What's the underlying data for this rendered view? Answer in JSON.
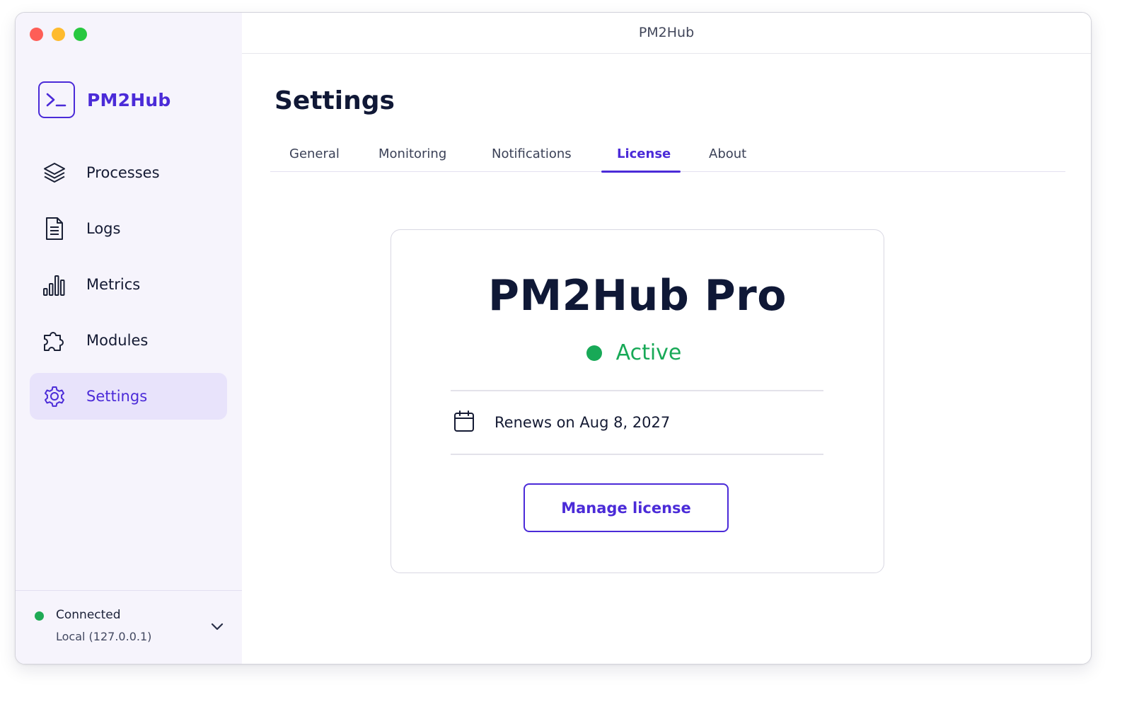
{
  "window": {
    "title": "PM2Hub"
  },
  "brand": {
    "name": "PM2Hub",
    "logo_icon": "terminal-icon"
  },
  "sidebar": {
    "items": [
      {
        "label": "Processes",
        "icon": "layers-icon",
        "active": false
      },
      {
        "label": "Logs",
        "icon": "document-icon",
        "active": false
      },
      {
        "label": "Metrics",
        "icon": "bar-chart-icon",
        "active": false
      },
      {
        "label": "Modules",
        "icon": "puzzle-icon",
        "active": false
      },
      {
        "label": "Settings",
        "icon": "gear-icon",
        "active": true
      }
    ],
    "connection": {
      "status": "Connected",
      "host": "Local  (127.0.0.1)",
      "status_color": "#1faa55"
    }
  },
  "main": {
    "title": "Settings",
    "tabs": [
      {
        "label": "General",
        "active": false
      },
      {
        "label": "Monitoring",
        "active": false
      },
      {
        "label": "Notifications",
        "active": false
      },
      {
        "label": "License",
        "active": true
      },
      {
        "label": "About",
        "active": false
      }
    ],
    "license": {
      "product": "PM2Hub Pro",
      "status": "Active",
      "status_color": "#18a957",
      "renewal": "Renews on Aug 8, 2027",
      "manage_button": "Manage license"
    }
  },
  "colors": {
    "accent": "#4b2bd8",
    "sidebar_bg": "#f6f4fc",
    "active_item_bg": "#e8e3fb"
  }
}
